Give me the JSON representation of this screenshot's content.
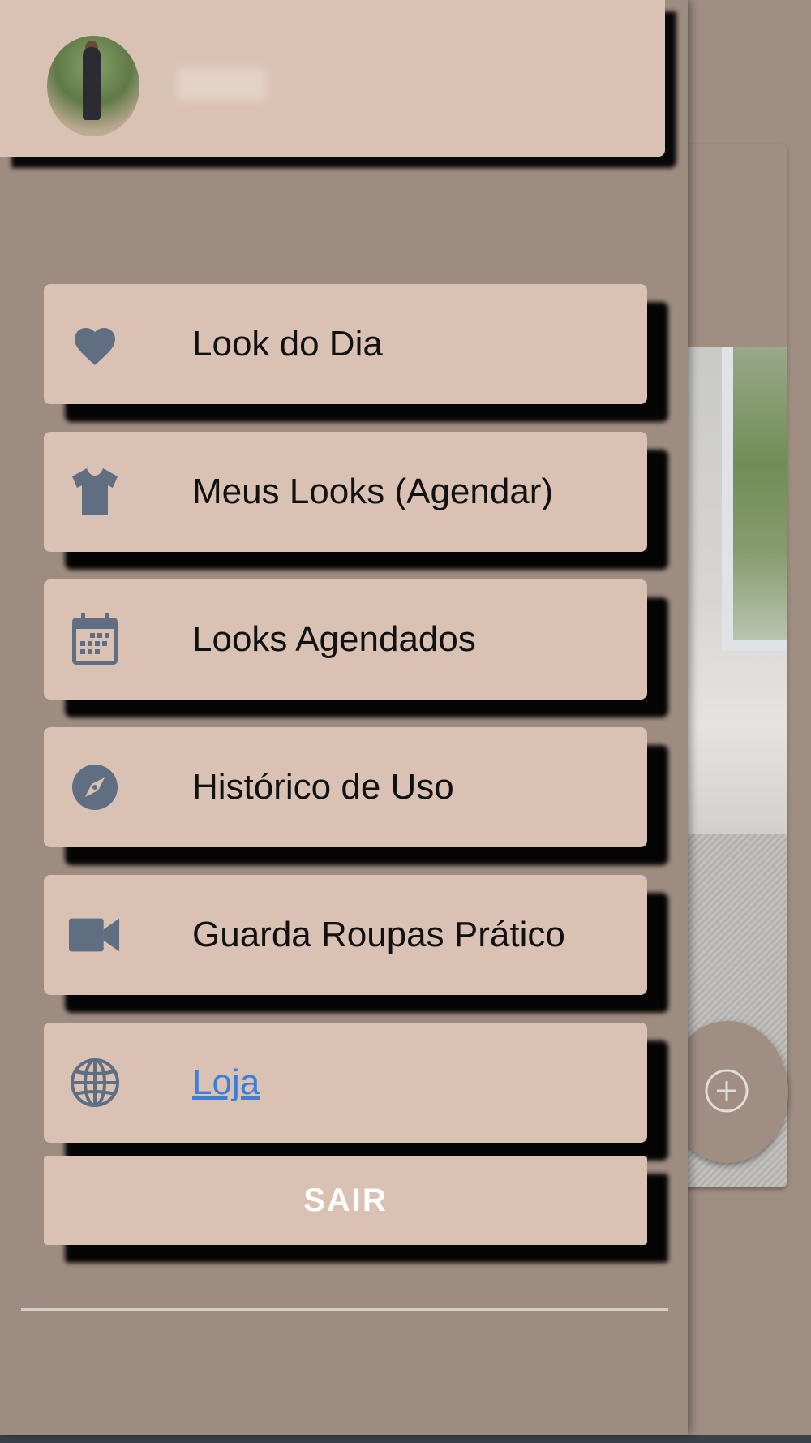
{
  "colors": {
    "drawer_bg": "#9f8c80",
    "item_bg": "#d9c1b3",
    "icon": "#5f6e80",
    "link": "#3d7ed8",
    "logout_text": "#ffffff"
  },
  "drawer": {
    "header": {
      "avatar": "profile-photo",
      "username": ""
    },
    "menu": [
      {
        "label": "Look do Dia",
        "icon": "heart-icon"
      },
      {
        "label": "Meus Looks (Agendar)",
        "icon": "tshirt-icon"
      },
      {
        "label": "Looks Agendados",
        "icon": "calendar-icon"
      },
      {
        "label": "Histórico de Uso",
        "icon": "compass-icon"
      },
      {
        "label": "Guarda Roupas Prático",
        "icon": "video-camera-icon"
      },
      {
        "label": "Loja",
        "icon": "globe-icon",
        "link": true
      }
    ],
    "logout_label": "SAIR"
  },
  "background": {
    "fab_icon": "add-circle-icon"
  }
}
